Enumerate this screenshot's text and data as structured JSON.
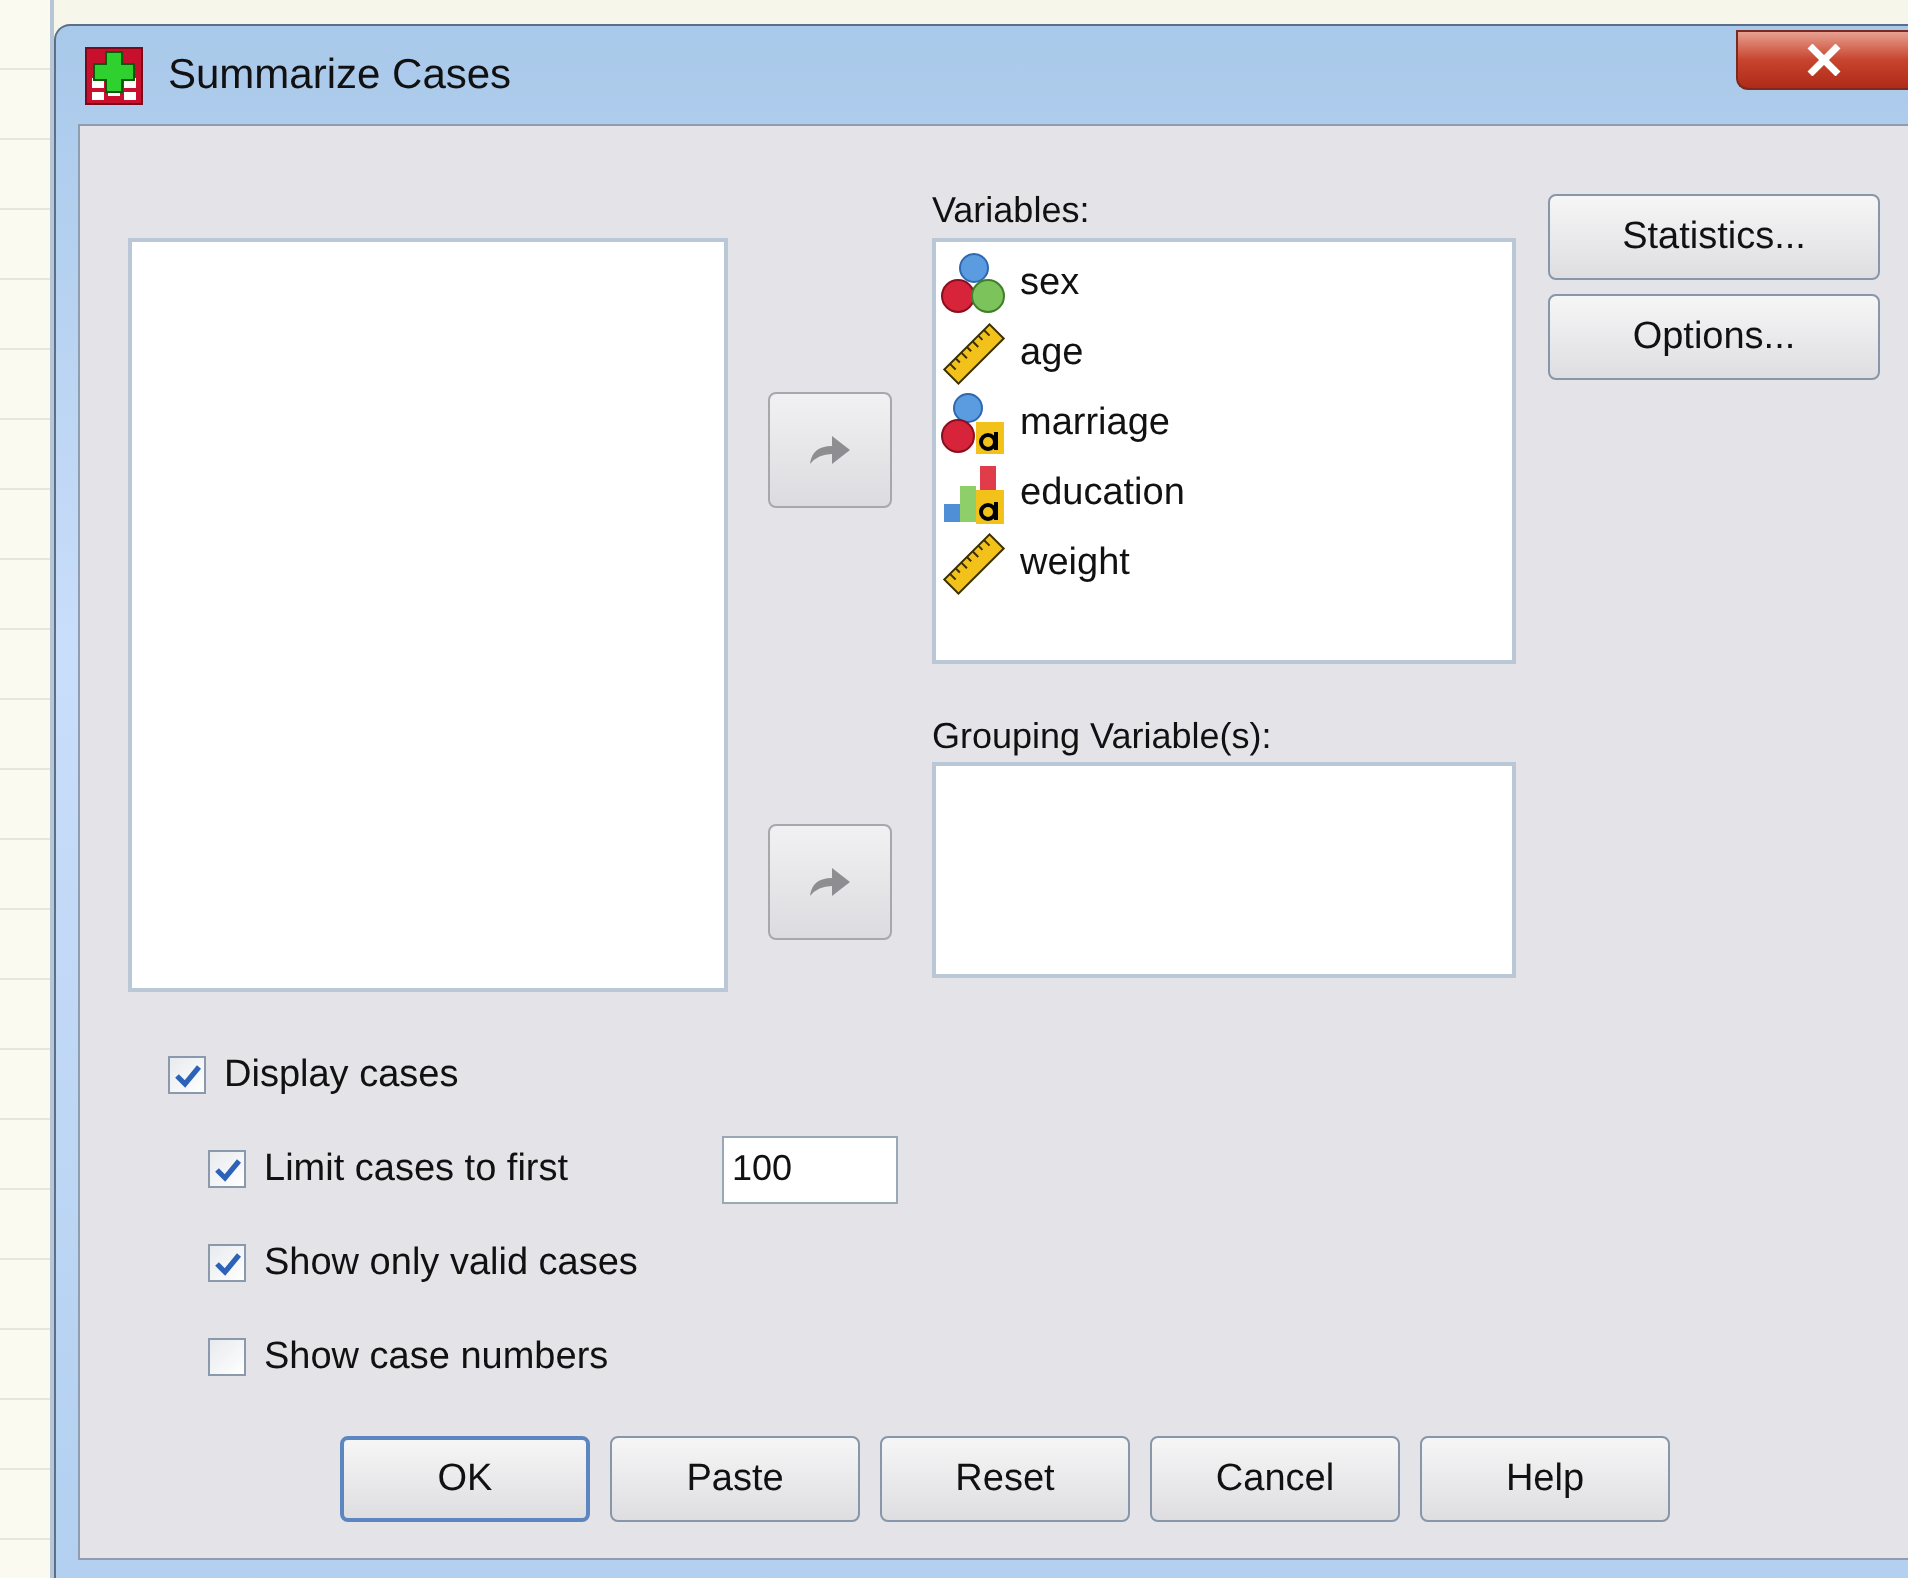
{
  "window": {
    "title": "Summarize Cases"
  },
  "transfer_buttons": [
    {
      "disabled": true
    },
    {
      "disabled": true
    }
  ],
  "variables": {
    "label": "Variables:",
    "items": [
      {
        "name": "sex",
        "kind": "nominal"
      },
      {
        "name": "age",
        "kind": "scale"
      },
      {
        "name": "marriage",
        "kind": "nominal_string"
      },
      {
        "name": "education",
        "kind": "ordinal_string"
      },
      {
        "name": "weight",
        "kind": "scale"
      }
    ]
  },
  "grouping": {
    "label": "Grouping Variable(s):"
  },
  "side_buttons": [
    "Statistics...",
    "Options..."
  ],
  "options": [
    {
      "label": "Display cases",
      "checked": true,
      "children": [
        {
          "label": "Limit cases to first",
          "checked": true,
          "value": "100"
        },
        {
          "label": "Show only valid cases",
          "checked": true
        },
        {
          "label": "Show case numbers",
          "checked": false
        }
      ]
    }
  ],
  "buttons": [
    {
      "label": "OK",
      "default": true
    },
    {
      "label": "Paste",
      "default": false
    },
    {
      "label": "Reset",
      "default": false
    },
    {
      "label": "Cancel",
      "default": false
    },
    {
      "label": "Help",
      "default": false
    }
  ]
}
